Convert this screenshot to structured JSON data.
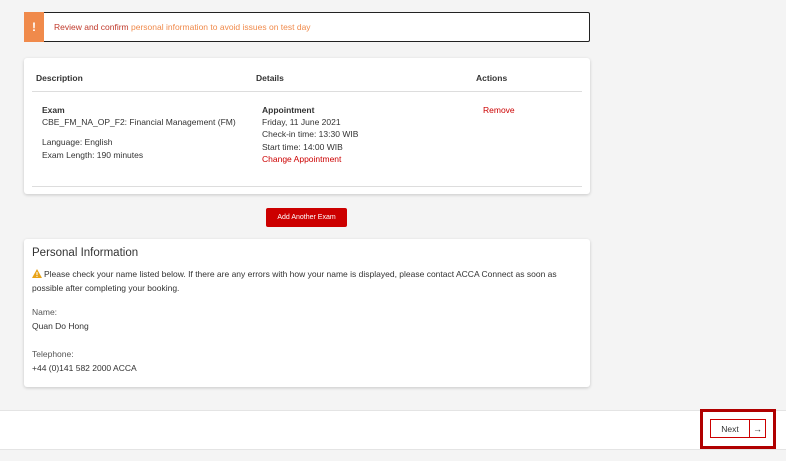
{
  "alert": {
    "icon": "exclamation-icon",
    "text_strong": "Review and confirm",
    "text_soft": "personal information to avoid issues on test day"
  },
  "exam_table": {
    "headers": {
      "description": "Description",
      "details": "Details",
      "actions": "Actions"
    },
    "row": {
      "exam_title": "Exam",
      "exam_code": "CBE_FM_NA_OP_F2: Financial Management (FM)",
      "language": "Language: English",
      "length": "Exam Length: 190 minutes",
      "appointment_title": "Appointment",
      "date": "Friday, 11 June 2021",
      "checkin": "Check-in time: 13:30 WIB",
      "start": "Start time: 14:00 WIB",
      "change_link": "Change Appointment",
      "remove_link": "Remove"
    }
  },
  "add_exam_button": "Add Another Exam",
  "personal_info": {
    "title": "Personal Information",
    "note": "Please check your name listed below. If there are any errors with how your name is displayed, please contact ACCA Connect as soon as possible after completing your booking.",
    "name_label": "Name:",
    "name_value": "Quan Do Hong",
    "telephone_label": "Telephone:",
    "telephone_value": "+44 (0)141 582 2000 ACCA"
  },
  "next_button": {
    "label": "Next",
    "icon": "arrow-right-icon"
  },
  "colors": {
    "accent": "#cc0000",
    "warning": "#f08a4b"
  }
}
